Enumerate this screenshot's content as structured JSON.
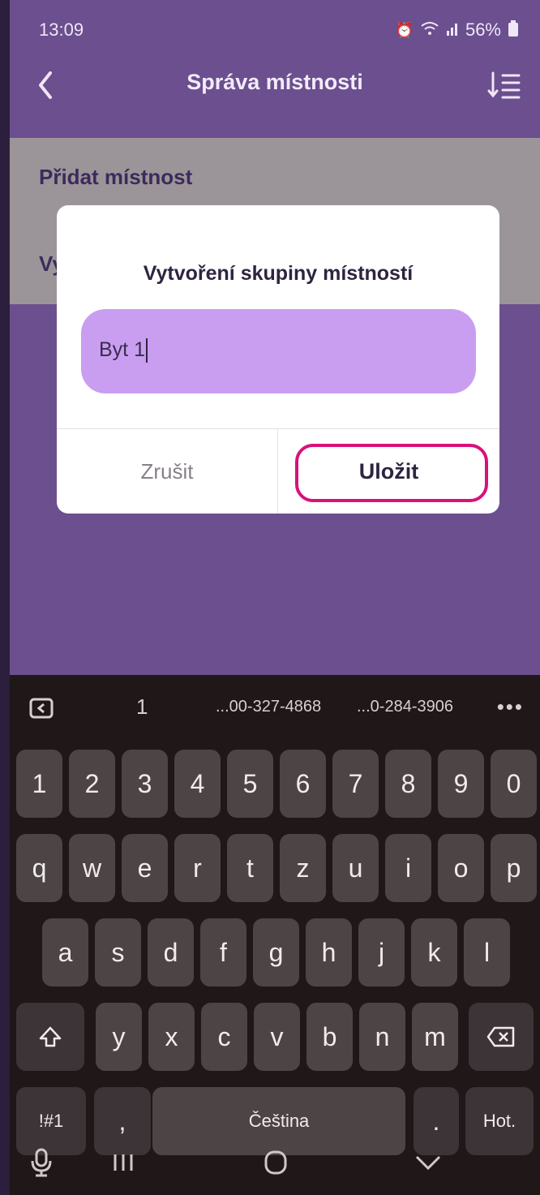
{
  "status_bar": {
    "time": "13:09",
    "battery": "56%"
  },
  "header": {
    "title": "Správa místnosti"
  },
  "list": {
    "add_room": "Přidat místnost",
    "second_item_visible": "Vy"
  },
  "dialog": {
    "title": "Vytvoření skupiny místností",
    "input_value": "Byt 1",
    "cancel_label": "Zrušit",
    "save_label": "Uložit"
  },
  "keyboard": {
    "suggestions": [
      "1",
      "...00-327-4868",
      "...0-284-3906"
    ],
    "row_numbers": [
      "1",
      "2",
      "3",
      "4",
      "5",
      "6",
      "7",
      "8",
      "9",
      "0"
    ],
    "row_q": [
      "q",
      "w",
      "e",
      "r",
      "t",
      "z",
      "u",
      "i",
      "o",
      "p"
    ],
    "row_a": [
      "a",
      "s",
      "d",
      "f",
      "g",
      "h",
      "j",
      "k",
      "l"
    ],
    "row_y": [
      "y",
      "x",
      "c",
      "v",
      "b",
      "n",
      "m"
    ],
    "symbols_label": "!#1",
    "comma": ",",
    "space_label": "Čeština",
    "period": ".",
    "enter_label": "Hot."
  },
  "icons": {
    "back": "back-arrow-icon",
    "sort": "sort-icon",
    "shift": "shift-icon",
    "backspace": "backspace-icon",
    "mic": "microphone-icon"
  },
  "colors": {
    "accent": "#d8127a",
    "header_bg": "#6b4f8e",
    "input_bg": "#c99ef1"
  }
}
